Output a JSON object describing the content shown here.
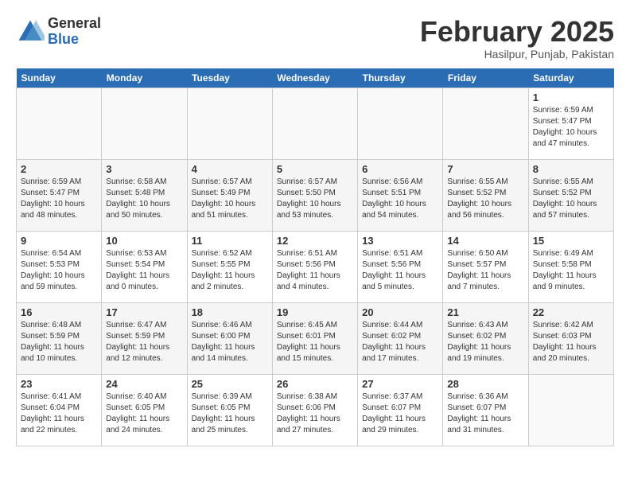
{
  "header": {
    "logo_general": "General",
    "logo_blue": "Blue",
    "month_title": "February 2025",
    "location": "Hasilpur, Punjab, Pakistan"
  },
  "calendar": {
    "days_of_week": [
      "Sunday",
      "Monday",
      "Tuesday",
      "Wednesday",
      "Thursday",
      "Friday",
      "Saturday"
    ],
    "weeks": [
      [
        {
          "day": "",
          "info": ""
        },
        {
          "day": "",
          "info": ""
        },
        {
          "day": "",
          "info": ""
        },
        {
          "day": "",
          "info": ""
        },
        {
          "day": "",
          "info": ""
        },
        {
          "day": "",
          "info": ""
        },
        {
          "day": "1",
          "info": "Sunrise: 6:59 AM\nSunset: 5:47 PM\nDaylight: 10 hours\nand 47 minutes."
        }
      ],
      [
        {
          "day": "2",
          "info": "Sunrise: 6:59 AM\nSunset: 5:47 PM\nDaylight: 10 hours\nand 48 minutes."
        },
        {
          "day": "3",
          "info": "Sunrise: 6:58 AM\nSunset: 5:48 PM\nDaylight: 10 hours\nand 50 minutes."
        },
        {
          "day": "4",
          "info": "Sunrise: 6:57 AM\nSunset: 5:49 PM\nDaylight: 10 hours\nand 51 minutes."
        },
        {
          "day": "5",
          "info": "Sunrise: 6:57 AM\nSunset: 5:50 PM\nDaylight: 10 hours\nand 53 minutes."
        },
        {
          "day": "6",
          "info": "Sunrise: 6:56 AM\nSunset: 5:51 PM\nDaylight: 10 hours\nand 54 minutes."
        },
        {
          "day": "7",
          "info": "Sunrise: 6:55 AM\nSunset: 5:52 PM\nDaylight: 10 hours\nand 56 minutes."
        },
        {
          "day": "8",
          "info": "Sunrise: 6:55 AM\nSunset: 5:52 PM\nDaylight: 10 hours\nand 57 minutes."
        }
      ],
      [
        {
          "day": "9",
          "info": "Sunrise: 6:54 AM\nSunset: 5:53 PM\nDaylight: 10 hours\nand 59 minutes."
        },
        {
          "day": "10",
          "info": "Sunrise: 6:53 AM\nSunset: 5:54 PM\nDaylight: 11 hours\nand 0 minutes."
        },
        {
          "day": "11",
          "info": "Sunrise: 6:52 AM\nSunset: 5:55 PM\nDaylight: 11 hours\nand 2 minutes."
        },
        {
          "day": "12",
          "info": "Sunrise: 6:51 AM\nSunset: 5:56 PM\nDaylight: 11 hours\nand 4 minutes."
        },
        {
          "day": "13",
          "info": "Sunrise: 6:51 AM\nSunset: 5:56 PM\nDaylight: 11 hours\nand 5 minutes."
        },
        {
          "day": "14",
          "info": "Sunrise: 6:50 AM\nSunset: 5:57 PM\nDaylight: 11 hours\nand 7 minutes."
        },
        {
          "day": "15",
          "info": "Sunrise: 6:49 AM\nSunset: 5:58 PM\nDaylight: 11 hours\nand 9 minutes."
        }
      ],
      [
        {
          "day": "16",
          "info": "Sunrise: 6:48 AM\nSunset: 5:59 PM\nDaylight: 11 hours\nand 10 minutes."
        },
        {
          "day": "17",
          "info": "Sunrise: 6:47 AM\nSunset: 5:59 PM\nDaylight: 11 hours\nand 12 minutes."
        },
        {
          "day": "18",
          "info": "Sunrise: 6:46 AM\nSunset: 6:00 PM\nDaylight: 11 hours\nand 14 minutes."
        },
        {
          "day": "19",
          "info": "Sunrise: 6:45 AM\nSunset: 6:01 PM\nDaylight: 11 hours\nand 15 minutes."
        },
        {
          "day": "20",
          "info": "Sunrise: 6:44 AM\nSunset: 6:02 PM\nDaylight: 11 hours\nand 17 minutes."
        },
        {
          "day": "21",
          "info": "Sunrise: 6:43 AM\nSunset: 6:02 PM\nDaylight: 11 hours\nand 19 minutes."
        },
        {
          "day": "22",
          "info": "Sunrise: 6:42 AM\nSunset: 6:03 PM\nDaylight: 11 hours\nand 20 minutes."
        }
      ],
      [
        {
          "day": "23",
          "info": "Sunrise: 6:41 AM\nSunset: 6:04 PM\nDaylight: 11 hours\nand 22 minutes."
        },
        {
          "day": "24",
          "info": "Sunrise: 6:40 AM\nSunset: 6:05 PM\nDaylight: 11 hours\nand 24 minutes."
        },
        {
          "day": "25",
          "info": "Sunrise: 6:39 AM\nSunset: 6:05 PM\nDaylight: 11 hours\nand 25 minutes."
        },
        {
          "day": "26",
          "info": "Sunrise: 6:38 AM\nSunset: 6:06 PM\nDaylight: 11 hours\nand 27 minutes."
        },
        {
          "day": "27",
          "info": "Sunrise: 6:37 AM\nSunset: 6:07 PM\nDaylight: 11 hours\nand 29 minutes."
        },
        {
          "day": "28",
          "info": "Sunrise: 6:36 AM\nSunset: 6:07 PM\nDaylight: 11 hours\nand 31 minutes."
        },
        {
          "day": "",
          "info": ""
        }
      ]
    ]
  }
}
